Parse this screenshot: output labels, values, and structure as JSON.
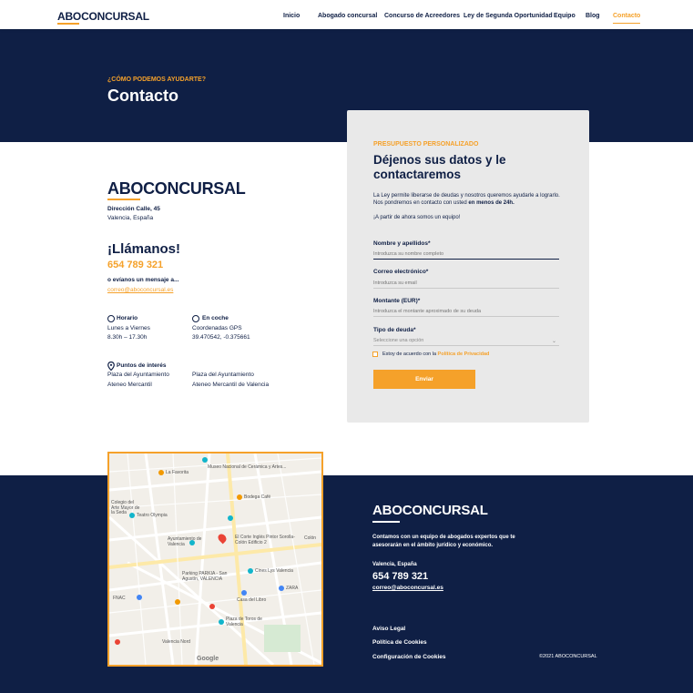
{
  "header": {
    "logo": "ABOCONCURSAL",
    "nav": [
      "Inicio",
      "Abogado concursal",
      "Concurso de Acreedores",
      "Ley de Segunda Oportunidad",
      "Equipo",
      "Blog",
      "Contacto"
    ]
  },
  "hero": {
    "eyebrow": "¿CÓMO PODEMOS AYUDARTE?",
    "title": "Contacto"
  },
  "contact": {
    "brand": "ABOCONCURSAL",
    "address1": "Dirección Calle, 45",
    "address2": "Valencia, España",
    "call_title": "¡Llámanos!",
    "phone": "654 789 321",
    "or_message": "o evíanos un mensaje a...",
    "email": "correo@aboconcursal.es",
    "hours_title": "Horario",
    "hours_days": "Lunes a Viernes",
    "hours_time": "8.30h – 17.30h",
    "car_title": "En coche",
    "car_line1": "Coordenadas GPS",
    "car_line2": "39.470542, -0.375661",
    "poi_title": "Puntos de interés",
    "poi_a1": "Plaza del Ayuntamiento",
    "poi_a2": "Ateneo Mercantil",
    "poi_b1": "Plaza del Ayuntamiento",
    "poi_b2": "Ateneo Mercantil de Valencia"
  },
  "form": {
    "eyebrow": "PRESUPUESTO PERSONALIZADO",
    "title": "Déjenos sus datos y le contactaremos",
    "intro": "La Ley permite liberarse de deudas y nosotros queremos ayudarle a lograrlo. Nos pondremos en contacto con usted",
    "intro_bold": "en menos de 24h.",
    "intro2": "¡A partir de ahora somos un equipo!",
    "name_label": "Nombre y apellidos*",
    "name_ph": "Introduzca su nombre completo",
    "email_label": "Correo electrónico*",
    "email_ph": "Introduzca su email",
    "amount_label": "Montante (EUR)*",
    "amount_ph": "Introduzca el montante aproximado de su deuda",
    "debt_label": "Tipo de deuda*",
    "debt_ph": "Seleccione una opción",
    "consent": "Estoy de acuerdo con la",
    "consent_link": "Política de Privacidad",
    "submit": "Enviar"
  },
  "map": {
    "labels": [
      "Museo Nacional de Cerámica y Artes...",
      "La Favorita",
      "Bodega Café",
      "Teatro Olympia",
      "Colegio del Arte Mayor de la Seda",
      "Ayuntamiento de Valencia",
      "El Corte Inglés Pintor Sorolla-Colón Edificio 2",
      "Parking PARKIA - San Agustín, VALENCIA",
      "Cines Lys Valencia",
      "Casa del Libro",
      "ZARA",
      "Plaza de Toros de Valencia",
      "Valencia Nord",
      "FNAC",
      "Google",
      "Colón"
    ]
  },
  "footer": {
    "brand": "ABOCONCURSAL",
    "desc1": "Contamos con un equipo de abogados expertos que te",
    "desc2": "asesorarán en el ámbito jurídico y económico.",
    "city": "Valencia, España",
    "phone": "654 789 321",
    "email": "correo@aboconcursal.es",
    "links": [
      "Aviso Legal",
      "Política de Cookies",
      "Configuración de Cookies"
    ],
    "copyright": "©2021 ABOCONCURSAL"
  },
  "colors": {
    "navy": "#0f1f45",
    "accent": "#f5a12a",
    "form_bg": "#e9e9e9"
  }
}
